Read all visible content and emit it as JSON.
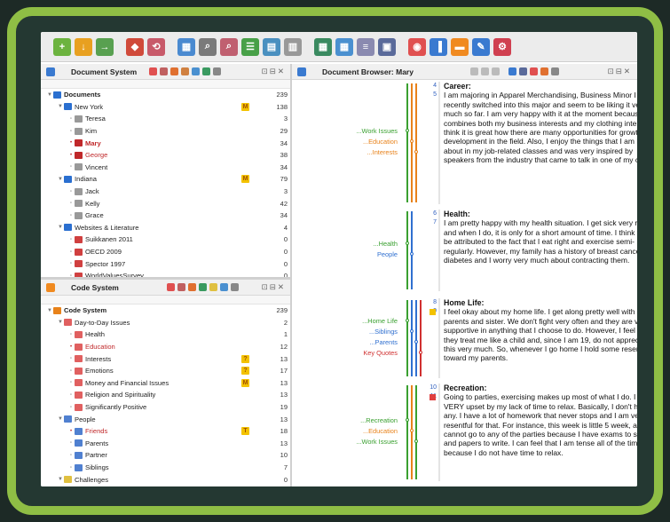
{
  "toolbar": {
    "icons": [
      "new-document-icon",
      "import-icon",
      "export-icon",
      "code-icon",
      "retrieve-icon",
      "table-icon",
      "search-icon",
      "lexical-search-icon",
      "list-icon",
      "overview-icon",
      "memo-icon",
      "matrix-icon",
      "browser-icon",
      "compare-icon",
      "print-icon",
      "settings-icon",
      "document-view-icon",
      "code-view-icon",
      "memo-view-icon",
      "visual-tools-icon"
    ]
  },
  "document_system": {
    "title": "Document System",
    "rows": [
      {
        "label": "Documents",
        "count": "239",
        "level": 0,
        "bold": true,
        "arrow": "▼",
        "memo": "",
        "color": "#2a6fd0"
      },
      {
        "label": "New York",
        "count": "138",
        "level": 1,
        "arrow": "▼",
        "memo": "M",
        "color": "#2a6fd0"
      },
      {
        "label": "Teresa",
        "count": "3",
        "level": 2,
        "arrow": "",
        "memo": "",
        "color": "#999"
      },
      {
        "label": "Kim",
        "count": "29",
        "level": 2,
        "arrow": "",
        "memo": "",
        "color": "#999"
      },
      {
        "label": "Mary",
        "count": "34",
        "level": 2,
        "arrow": "",
        "memo": "",
        "color": "#c0282a",
        "red": true,
        "bold": true
      },
      {
        "label": "George",
        "count": "38",
        "level": 2,
        "arrow": "",
        "memo": "",
        "color": "#c0282a",
        "red": true
      },
      {
        "label": "Vincent",
        "count": "34",
        "level": 2,
        "arrow": "",
        "memo": "",
        "color": "#999"
      },
      {
        "label": "Indiana",
        "count": "79",
        "level": 1,
        "arrow": "▼",
        "memo": "M",
        "color": "#2a6fd0"
      },
      {
        "label": "Jack",
        "count": "3",
        "level": 2,
        "arrow": "",
        "memo": "",
        "color": "#999"
      },
      {
        "label": "Kelly",
        "count": "42",
        "level": 2,
        "arrow": "",
        "memo": "",
        "color": "#999"
      },
      {
        "label": "Grace",
        "count": "34",
        "level": 2,
        "arrow": "",
        "memo": "",
        "color": "#999"
      },
      {
        "label": "Websites & Literature",
        "count": "4",
        "level": 1,
        "arrow": "▼",
        "memo": "",
        "color": "#2a6fd0"
      },
      {
        "label": "Suikkanen 2011",
        "count": "0",
        "level": 2,
        "arrow": "",
        "memo": "",
        "color": "#d04040"
      },
      {
        "label": "OECD 2009",
        "count": "0",
        "level": 2,
        "arrow": "",
        "memo": "",
        "color": "#d04040"
      },
      {
        "label": "Spector 1997",
        "count": "0",
        "level": 2,
        "arrow": "",
        "memo": "",
        "color": "#d04040"
      },
      {
        "label": "WorldValuesSurvey",
        "count": "0",
        "level": 2,
        "arrow": "",
        "memo": "",
        "color": "#d04040"
      }
    ]
  },
  "code_system": {
    "title": "Code System",
    "rows": [
      {
        "label": "Code System",
        "count": "239",
        "level": 0,
        "bold": true,
        "arrow": "▼",
        "memo": "",
        "color": "#e8821a"
      },
      {
        "label": "Day-to-Day Issues",
        "count": "2",
        "level": 1,
        "arrow": "▼",
        "memo": "",
        "color": "#e06060"
      },
      {
        "label": "Health",
        "count": "1",
        "level": 2,
        "arrow": "",
        "memo": "",
        "color": "#e06060"
      },
      {
        "label": "Education",
        "count": "12",
        "level": 2,
        "arrow": "",
        "memo": "",
        "color": "#e06060",
        "red": true
      },
      {
        "label": "Interests",
        "count": "13",
        "level": 2,
        "arrow": "",
        "memo": "?",
        "color": "#e06060"
      },
      {
        "label": "Emotions",
        "count": "17",
        "level": 2,
        "arrow": "",
        "memo": "?",
        "color": "#e06060"
      },
      {
        "label": "Money and Financial Issues",
        "count": "13",
        "level": 2,
        "arrow": "",
        "memo": "M",
        "color": "#e06060"
      },
      {
        "label": "Religion and Spirituality",
        "count": "13",
        "level": 2,
        "arrow": "",
        "memo": "",
        "color": "#e06060"
      },
      {
        "label": "Significantly Positive",
        "count": "19",
        "level": 2,
        "arrow": "",
        "memo": "",
        "color": "#e06060"
      },
      {
        "label": "People",
        "count": "13",
        "level": 1,
        "arrow": "▼",
        "memo": "",
        "color": "#5080d0"
      },
      {
        "label": "Friends",
        "count": "18",
        "level": 2,
        "arrow": "",
        "memo": "T",
        "color": "#5080d0",
        "red": true
      },
      {
        "label": "Parents",
        "count": "13",
        "level": 2,
        "arrow": "",
        "memo": "",
        "color": "#5080d0"
      },
      {
        "label": "Partner",
        "count": "10",
        "level": 2,
        "arrow": "",
        "memo": "",
        "color": "#5080d0"
      },
      {
        "label": "Siblings",
        "count": "7",
        "level": 2,
        "arrow": "",
        "memo": "",
        "color": "#5080d0"
      },
      {
        "label": "Challenges",
        "count": "0",
        "level": 1,
        "arrow": "▼",
        "memo": "",
        "color": "#e0c040"
      }
    ]
  },
  "document_browser": {
    "title": "Document Browser: Mary",
    "paragraphs": [
      {
        "nums": [
          "4",
          "5"
        ],
        "heading": "Career:",
        "text": "I am majoring in Apparel Merchandising, Business Minor I just recently switched into this major and seem to be liking it very much so far. I am very happy with it at the moment because it combines both my business interests and my clothing interests. I think it is great how there are many opportunities for growth and development in the field. Also, I enjoy the things that I am learning about in my job-related classes and was very inspired by speakers from the industry that came to talk in one of my classes."
      },
      {
        "nums": [
          "6",
          "7"
        ],
        "heading": "Health:",
        "text": "I am pretty happy with my health situation. I get sick very rarely and when I do, it is only for a short amount of time. I think this can be attributed to the fact that I eat right and exercise semi-regularly. However, my family has a history of breast cancer and diabetes and I worry very much about contracting them."
      },
      {
        "nums": [
          "8",
          "9"
        ],
        "heading": "Home Life:",
        "text": "I feel okay about my home life. I get along pretty well with my parents and sister. We don't fight very often and they are very supportive in anything that I choose to do. However, I feel like they treat me like a child and, since I am 19, do not appreciate this very much.  So, whenever I go home I hold some resentment toward my parents."
      },
      {
        "nums": [
          "10",
          "11"
        ],
        "heading": "Recreation:",
        "text": "Going to parties, exercising makes up most of what I do. I am VERY upset by my lack of time to relax. Basically, I don't have any. I have a lot of homework that never stops and I am very resentful for that. For instance, this week is little 5 week, and I cannot go to any of the parties because I have exams to study for and papers to write. I can feel that I am tense all of the time because I do not have time to relax."
      }
    ],
    "code_tags": [
      {
        "group": 0,
        "labels": [
          {
            "text": "...Work Issues",
            "color": "#3aa030"
          },
          {
            "text": "...Education",
            "color": "#e8821a"
          },
          {
            "text": "...Interests",
            "color": "#e8821a"
          }
        ]
      },
      {
        "group": 1,
        "labels": [
          {
            "text": "...Health",
            "color": "#3aa030"
          },
          {
            "text": "People",
            "color": "#3070d0"
          }
        ]
      },
      {
        "group": 2,
        "labels": [
          {
            "text": "...Home Life",
            "color": "#3aa030"
          },
          {
            "text": "...Siblings",
            "color": "#3070d0"
          },
          {
            "text": "...Parents",
            "color": "#3070d0"
          },
          {
            "text": "Key Quotes",
            "color": "#d03030"
          }
        ]
      },
      {
        "group": 3,
        "labels": [
          {
            "text": "...Recreation",
            "color": "#3aa030"
          },
          {
            "text": "...Education",
            "color": "#e8821a"
          },
          {
            "text": "...Work Issues",
            "color": "#3aa030"
          }
        ]
      }
    ]
  }
}
